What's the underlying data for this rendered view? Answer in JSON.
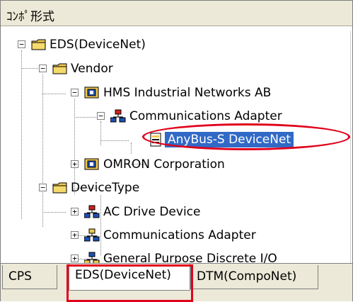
{
  "header": {
    "title": "ｺﾝﾎﾟ形式"
  },
  "tree": {
    "items": [
      {
        "label": "EDS(DeviceNet)",
        "expander": "−"
      },
      {
        "label": "Vendor",
        "expander": "−"
      },
      {
        "label": "HMS Industrial Networks AB",
        "expander": "−"
      },
      {
        "label": "Communications Adapter",
        "expander": "−"
      },
      {
        "label": "AnyBus-S DeviceNet",
        "selected": true
      },
      {
        "label": "OMRON Corporation",
        "expander": "+"
      },
      {
        "label": "DeviceType",
        "expander": "−"
      },
      {
        "label": "AC Drive Device",
        "expander": "+"
      },
      {
        "label": "Communications Adapter",
        "expander": "+"
      },
      {
        "label": "General Purpose Discrete I/O",
        "expander": "+"
      }
    ]
  },
  "tabs": [
    {
      "label": "CPS"
    },
    {
      "label": "EDS(DeviceNet)",
      "active": true
    },
    {
      "label": "DTM(CompoNet)"
    }
  ],
  "colors": {
    "selection": "#3169c6",
    "highlight": "#e0001b",
    "folder": "#f0c850",
    "network": "#d02020"
  }
}
